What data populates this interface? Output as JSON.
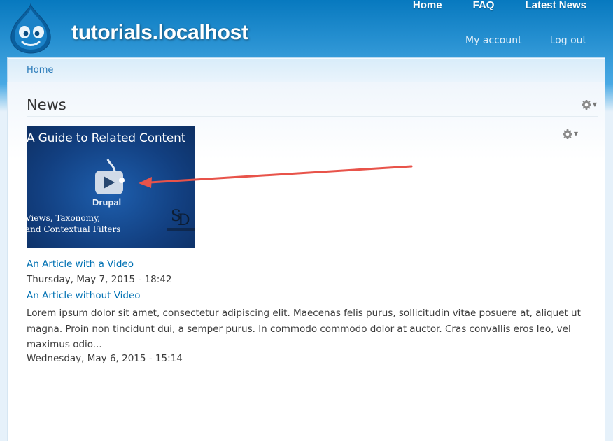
{
  "site": {
    "name": "tutorials.localhost"
  },
  "main_menu": [
    {
      "label": "Home"
    },
    {
      "label": "FAQ"
    },
    {
      "label": "Latest News"
    }
  ],
  "secondary_menu": [
    {
      "label": "My account"
    },
    {
      "label": "Log out"
    }
  ],
  "breadcrumb": {
    "home_label": "Home"
  },
  "page": {
    "title": "News"
  },
  "thumbnail": {
    "title": "A Guide to Related Content",
    "subtitle_line1": "Views, Taxonomy,",
    "subtitle_line2": "and Contextual Filters",
    "brand": "Drupal"
  },
  "articles": [
    {
      "title": "An Article with a Video",
      "date": "Thursday, May 7, 2015 - 18:42"
    },
    {
      "title": "An Article without Video",
      "body": "Lorem ipsum dolor sit amet, consectetur adipiscing elit. Maecenas felis purus, sollicitudin vitae posuere at, aliquet ut magna. Proin non tincidunt dui, a semper purus. In commodo commodo dolor at auctor. Cras convallis eros leo, vel maximus odio...",
      "date": "Wednesday, May 6, 2015 - 15:14"
    }
  ],
  "colors": {
    "header_blue": "#0779bf",
    "link_blue": "#0071b3",
    "annotation_arrow": "#e8534a"
  },
  "icons": {
    "logo": "drupal-drop-icon",
    "page_config": "gear-icon",
    "view_config": "gear-icon",
    "play": "play-icon"
  }
}
